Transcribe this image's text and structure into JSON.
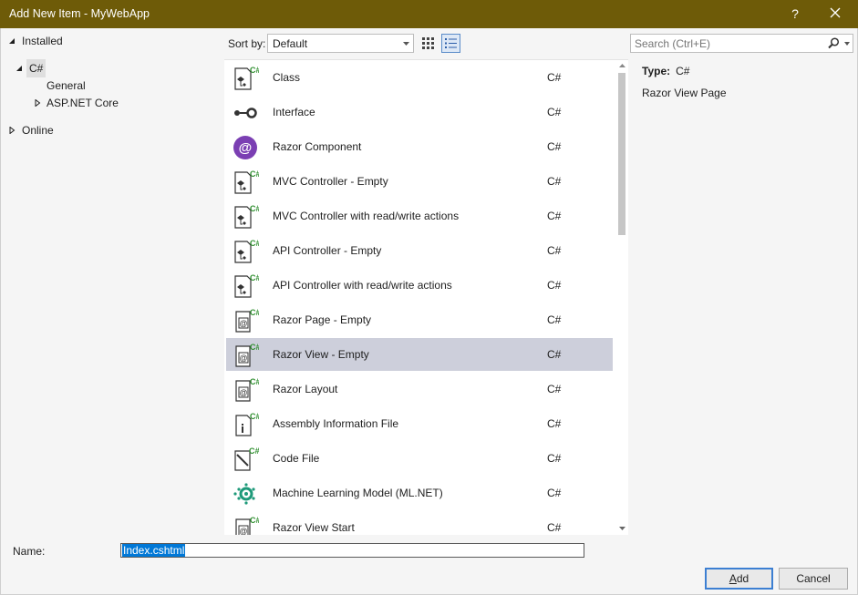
{
  "window": {
    "title": "Add New Item - MyWebApp",
    "help_label": "?"
  },
  "tree": {
    "installed": "Installed",
    "csharp": "C#",
    "general": "General",
    "aspnet": "ASP.NET Core",
    "online": "Online"
  },
  "toolbar": {
    "sort_label": "Sort by:",
    "sort_value": "Default"
  },
  "search": {
    "placeholder": "Search (Ctrl+E)"
  },
  "items": [
    {
      "name": "Class",
      "lang": "C#",
      "icon": "class-icon"
    },
    {
      "name": "Interface",
      "lang": "C#",
      "icon": "interface-icon"
    },
    {
      "name": "Razor Component",
      "lang": "C#",
      "icon": "razor-component-icon"
    },
    {
      "name": "MVC Controller - Empty",
      "lang": "C#",
      "icon": "controller-icon"
    },
    {
      "name": "MVC Controller with read/write actions",
      "lang": "C#",
      "icon": "controller-icon"
    },
    {
      "name": "API Controller - Empty",
      "lang": "C#",
      "icon": "controller-icon"
    },
    {
      "name": "API Controller with read/write actions",
      "lang": "C#",
      "icon": "controller-icon"
    },
    {
      "name": "Razor Page - Empty",
      "lang": "C#",
      "icon": "razor-page-icon"
    },
    {
      "name": "Razor View - Empty",
      "lang": "C#",
      "icon": "razor-view-icon",
      "selected": true
    },
    {
      "name": "Razor Layout",
      "lang": "C#",
      "icon": "razor-layout-icon"
    },
    {
      "name": "Assembly Information File",
      "lang": "C#",
      "icon": "assembly-info-icon"
    },
    {
      "name": "Code File",
      "lang": "C#",
      "icon": "code-file-icon"
    },
    {
      "name": "Machine Learning Model (ML.NET)",
      "lang": "C#",
      "icon": "ml-model-icon"
    },
    {
      "name": "Razor View Start",
      "lang": "C#",
      "icon": "razor-view-start-icon"
    }
  ],
  "details": {
    "type_label": "Type:",
    "type_value": "C#",
    "description": "Razor View Page"
  },
  "footer": {
    "name_label": "Name:",
    "name_value": "Index.cshtml",
    "add_label_underlined": "A",
    "add_label_rest": "dd",
    "cancel_label": "Cancel"
  },
  "colors": {
    "titlebar": "#6e5b08",
    "selection": "#cdcfdb",
    "accent": "#0078d7",
    "csharp_badge": "#2f8f2f",
    "razor_component": "#7b3fb3",
    "ml_model": "#1e9a7a"
  }
}
